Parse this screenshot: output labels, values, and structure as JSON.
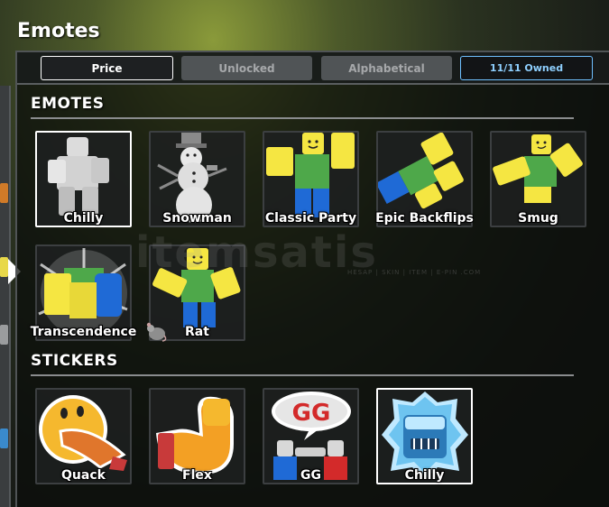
{
  "window": {
    "title": "Emotes"
  },
  "sort": {
    "price": "Price",
    "unlocked": "Unlocked",
    "alphabetical": "Alphabetical",
    "owned": "11/11 Owned"
  },
  "emotes": {
    "heading": "EMOTES",
    "items": [
      {
        "label": "Chilly",
        "selected": true
      },
      {
        "label": "Snowman"
      },
      {
        "label": "Classic Party"
      },
      {
        "label": "Epic Backflips"
      },
      {
        "label": "Smug"
      },
      {
        "label": "Transcendence"
      },
      {
        "label": "Rat"
      }
    ]
  },
  "stickers": {
    "heading": "STICKERS",
    "items": [
      {
        "label": "Quack"
      },
      {
        "label": "Flex"
      },
      {
        "label": "GG",
        "bubble_text": "GG"
      },
      {
        "label": "Chilly",
        "selected": true
      }
    ]
  },
  "watermark": {
    "brand": "itemsatis",
    "sub": "HESAP | SKIN | ITEM | E-PIN  .COM"
  },
  "colors": {
    "noob_yellow": "#f5e642",
    "noob_green": "#4ea84a",
    "noob_blue": "#1f6ad6",
    "owned_accent": "#8fd0ff",
    "selected_border": "#ffffff"
  }
}
